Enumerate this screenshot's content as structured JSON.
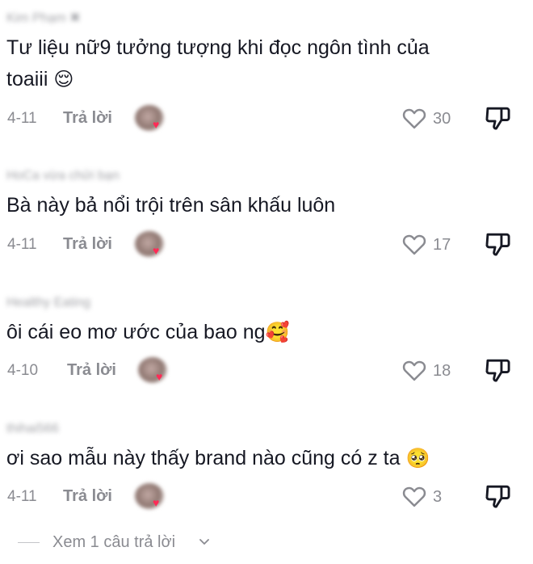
{
  "comments": [
    {
      "username": "Kim Phạm ✖",
      "text_line1": "Tư liệu nữ9 tưởng tượng khi đọc ngôn tình của",
      "text_line2": "toaiii",
      "emoji": "😌",
      "date": "4-11",
      "reply_label": "Trả lời",
      "likes": "30"
    },
    {
      "username": "HoCa vừa chửi bạn",
      "text_line1": "Bà này bả nổi trội trên sân khấu luôn",
      "text_line2": "",
      "emoji": "",
      "date": "4-11",
      "reply_label": "Trả lời",
      "likes": "17"
    },
    {
      "username": "Healthy Eating",
      "text_line1": "ôi cái eo mơ ước của bao ng",
      "text_line2": "",
      "emoji": "🥰",
      "date": "4-10",
      "reply_label": "Trả lời",
      "likes": "18"
    },
    {
      "username": "thihai566",
      "text_line1": "ơi sao mẫu này thấy brand nào cũng có z ta",
      "text_line2": "",
      "emoji": "🥺",
      "date": "4-11",
      "reply_label": "Trả lời",
      "likes": "3"
    }
  ],
  "footer": {
    "view_replies": "Xem 1 câu trả lời"
  },
  "colors": {
    "text": "#161823",
    "muted": "#8a8b91",
    "heart_accent": "#ff2b56"
  },
  "icons": {
    "like": "heart-outline-icon",
    "dislike": "thumbs-down-icon",
    "expand": "chevron-down-icon"
  }
}
